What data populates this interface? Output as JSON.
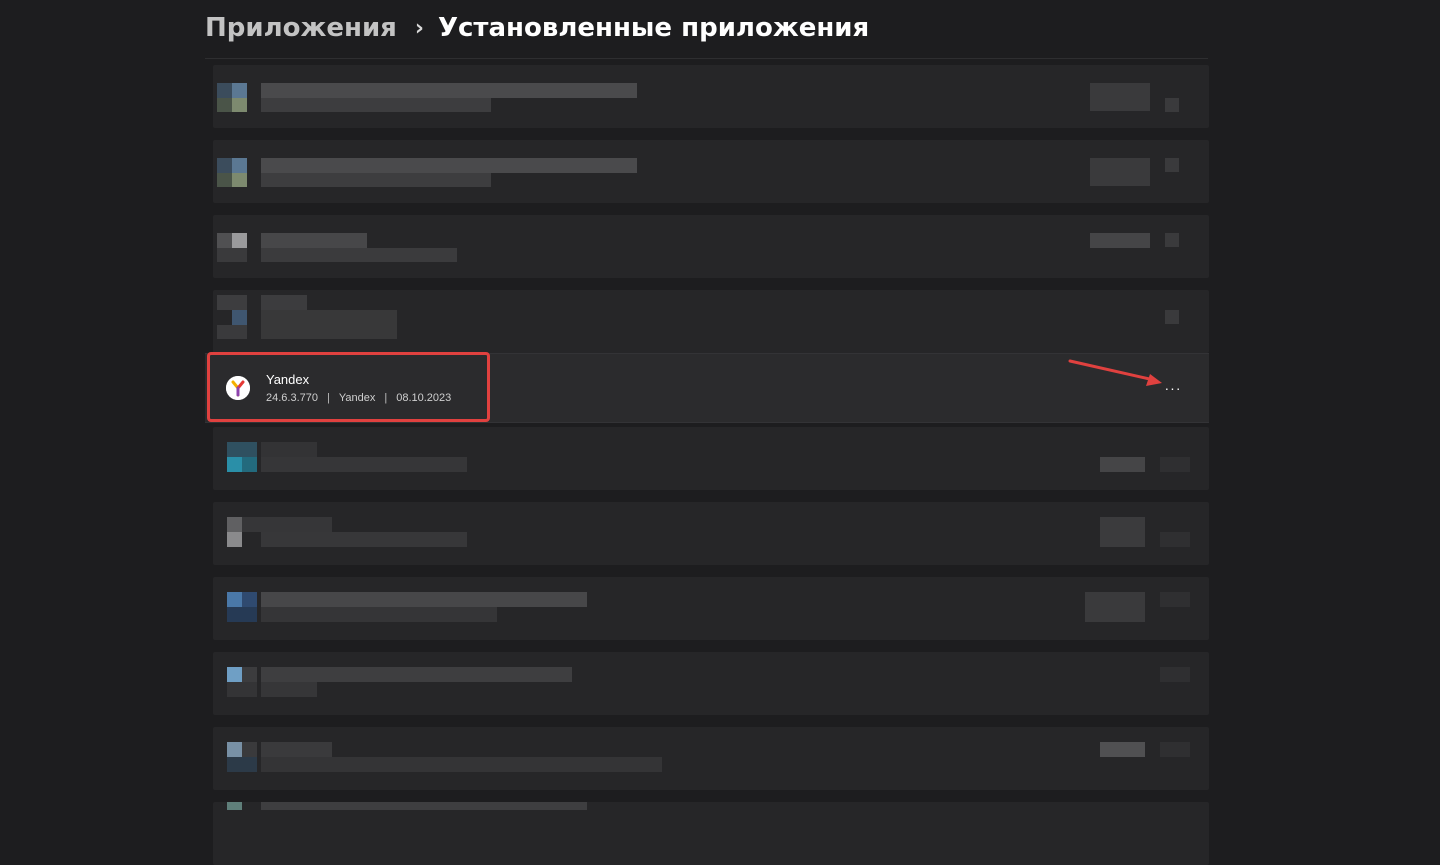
{
  "breadcrumb": {
    "parent": "Приложения",
    "separator": "›",
    "current": "Установленные приложения"
  },
  "yandex_app": {
    "name": "Yandex",
    "version": "24.6.3.770",
    "publisher": "Yandex",
    "date": "08.10.2023",
    "separator": "|",
    "more_label": "···",
    "icon": "yandex-browser-icon"
  },
  "colors": {
    "background": "#1d1d1f",
    "row": "#262628",
    "highlight": "#e0413f",
    "arrow": "#e0413f",
    "text": "#ffffff"
  },
  "annotations": {
    "arrow_icon": "red-arrow-icon"
  }
}
